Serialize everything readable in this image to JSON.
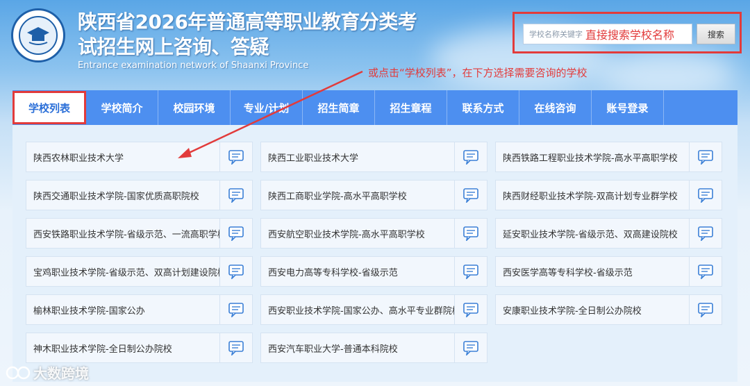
{
  "header": {
    "title_line1": "陕西省2026年普通高等职业教育分类考",
    "title_line2": "试招生网上咨询、答疑",
    "subtitle": "Entrance examination network of Shaanxi Province"
  },
  "search": {
    "placeholder": "学校名称关键字",
    "hint": "直接搜索学校名称",
    "button_label": "搜索"
  },
  "annotation": "或点击“学校列表”，在下方选择需要咨询的学校",
  "nav": {
    "items": [
      "学校列表",
      "学校简介",
      "校园环境",
      "专业/计划",
      "招生简章",
      "招生章程",
      "联系方式",
      "在线咨询",
      "账号登录"
    ],
    "active": "学校列表"
  },
  "schools": [
    "陕西农林职业技术大学",
    "陕西工业职业技术大学",
    "陕西铁路工程职业技术学院-高水平高职学校",
    "陕西交通职业技术学院-国家优质高职院校",
    "陕西工商职业学院-高水平高职学校",
    "陕西财经职业技术学院-双高计划专业群学校",
    "西安铁路职业技术学院-省级示范、一流高职学校",
    "西安航空职业技术学院-高水平高职学校",
    "延安职业技术学院-省级示范、双高建设院校",
    "宝鸡职业技术学院-省级示范、双高计划建设院校",
    "西安电力高等专科学校-省级示范",
    "西安医学高等专科学校-省级示范",
    "榆林职业技术学院-国家公办",
    "西安职业技术学院-国家公办、高水平专业群院校",
    "安康职业技术学院-全日制公办院校",
    "神木职业技术学院-全日制公办院校",
    "西安汽车职业大学-普通本科院校"
  ],
  "watermark": "大数跨境",
  "colors": {
    "nav": "#4d8ff0",
    "highlight": "#e23b3b",
    "icon": "#3a7fd6"
  },
  "icons": {
    "consult": "chat-bubble-icon",
    "logo": "university-emblem"
  }
}
